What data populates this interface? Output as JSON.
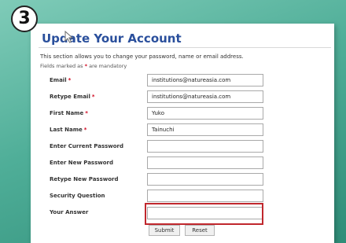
{
  "step": {
    "number": "3"
  },
  "page": {
    "title": "Update Your Account",
    "intro": "This section allows you to change your password, name or email address.",
    "mandatory_prefix": "Fields marked as",
    "mandatory_star": "*",
    "mandatory_suffix": "are mandatory"
  },
  "form": {
    "fields": [
      {
        "label": "Email",
        "required": true,
        "value": "institutions@natureasia.com"
      },
      {
        "label": "Retype Email",
        "required": true,
        "value": "institutions@natureasia.com"
      },
      {
        "label": "First Name",
        "required": true,
        "value": "Yuko"
      },
      {
        "label": "Last Name",
        "required": true,
        "value": "Tainuchi"
      },
      {
        "label": "Enter Current Password",
        "required": false,
        "value": ""
      },
      {
        "label": "Enter New Password",
        "required": false,
        "value": ""
      },
      {
        "label": "Retype New Password",
        "required": false,
        "value": ""
      },
      {
        "label": "Security Question",
        "required": false,
        "value": ""
      },
      {
        "label": "Your Answer",
        "required": false,
        "value": ""
      }
    ],
    "submit_label": "Submit",
    "reset_label": "Reset"
  },
  "colors": {
    "title": "#2a4f9c",
    "required_star": "#d0021b",
    "highlight": "#c0272d",
    "background": "#4fae98"
  },
  "icons": {
    "cursor": "arrow-cursor-icon"
  }
}
